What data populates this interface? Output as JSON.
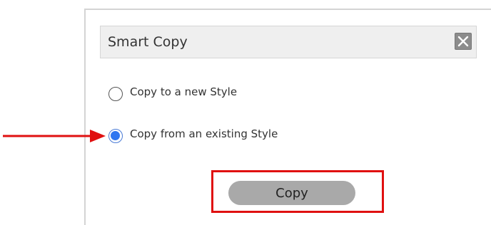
{
  "dialog": {
    "title": "Smart Copy",
    "close_icon": "close-icon"
  },
  "options": [
    {
      "label": "Copy to a new Style",
      "selected": false
    },
    {
      "label": "Copy from an existing Style",
      "selected": true
    }
  ],
  "copy_button": {
    "label": "Copy"
  },
  "annotations": {
    "arrow_color": "#e01010",
    "highlight_color": "#e01010"
  },
  "colors": {
    "radio_selected": "#2f76f0",
    "button_bg": "#a9a9a9",
    "titlebar_bg": "#efefef"
  }
}
